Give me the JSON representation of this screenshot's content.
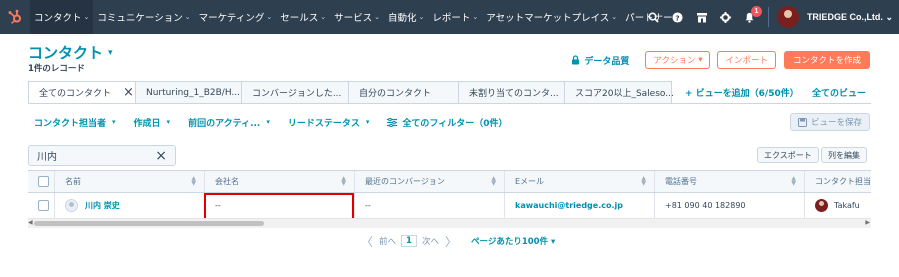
{
  "topnav": {
    "items": [
      {
        "label": "コンタクト",
        "active": true
      },
      {
        "label": "コミュニケーション",
        "active": false
      },
      {
        "label": "マーケティング",
        "active": false
      },
      {
        "label": "セールス",
        "active": false
      },
      {
        "label": "サービス",
        "active": false
      },
      {
        "label": "自動化",
        "active": false
      },
      {
        "label": "レポート",
        "active": false
      },
      {
        "label": "アセットマーケットプレイス",
        "active": false
      },
      {
        "label": "パートナー",
        "active": false
      }
    ],
    "icons": [
      "search-icon",
      "help-icon",
      "marketplace-icon",
      "settings-icon",
      "notifications-icon"
    ],
    "notification_count": "1",
    "account_name": "TRIEDGE Co.,Ltd."
  },
  "header": {
    "title": "コンタクト",
    "record_count": "1件のレコード",
    "data_quality": "データ品質",
    "actions_label": "アクション",
    "import_label": "インポート",
    "create_label": "コンタクトを作成"
  },
  "view_tabs": {
    "tabs": [
      {
        "label": "全てのコンタクト",
        "active": true
      },
      {
        "label": "Nurturing_1_B2B/H...",
        "active": false
      },
      {
        "label": "コンバージョンした...",
        "active": false
      },
      {
        "label": "自分のコンタクト",
        "active": false
      },
      {
        "label": "未割り当てのコンタ...",
        "active": false
      },
      {
        "label": "スコア20以上_Saleso...",
        "active": false
      }
    ],
    "add_view": "+ ビューを追加（6/50件）",
    "all_views": "全てのビュー"
  },
  "filters": {
    "items": [
      "コンタクト担当者",
      "作成日",
      "前回のアクティ...",
      "リードステータス"
    ],
    "all_filters": "全てのフィルター（0件）",
    "save_view": "ビューを保存"
  },
  "table_tools": {
    "search_value": "川内",
    "export_label": "エクスポート",
    "edit_columns_label": "列を編集"
  },
  "table": {
    "columns": [
      "名前",
      "会社名",
      "最近のコンバージョン",
      "Eメール",
      "電話番号",
      "コンタクト担当"
    ],
    "rows": [
      {
        "name": "川内 崇史",
        "company": "--",
        "recent_conversion": "--",
        "email": "kawauchi@triedge.co.jp",
        "phone": "+81 090 40 182890",
        "owner": "Takafu"
      }
    ]
  },
  "pagination": {
    "prev": "前へ",
    "page": "1",
    "next": "次へ",
    "per_page": "ページあたり100件"
  },
  "colors": {
    "nav_bg": "#2e3f50",
    "accent": "#0091ae",
    "brand_orange": "#ff7a59",
    "highlight": "#e00000"
  }
}
